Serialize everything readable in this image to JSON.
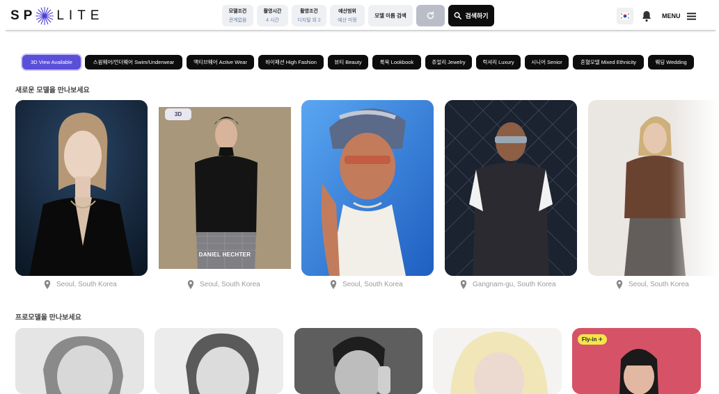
{
  "brand": {
    "left": "SP",
    "right": "LITE"
  },
  "filters": [
    {
      "title": "모델조건",
      "value": "관계없음"
    },
    {
      "title": "촬영시간",
      "value": "4 시간"
    },
    {
      "title": "촬영조건",
      "value": "디지털 외 2"
    },
    {
      "title": "예산범위",
      "value": "예산 미정"
    }
  ],
  "name_search_label": "모델 이름 검색",
  "search_button_label": "검색하기",
  "menu_label": "MENU",
  "categories": [
    "3D View Available",
    "스윔웨어/언더웨어 Swim/Underwear",
    "액티브웨어 Active Wear",
    "하이패션 High Fashion",
    "뷰티 Beauty",
    "룩북 Lookbook",
    "쥬얼리 Jewelry",
    "럭셔리 Luxury",
    "시니어 Senior",
    "혼혈모델 Mixed Ethnicity",
    "웨딩 Wedding"
  ],
  "section_new": {
    "title": "새로운 모델을 만나보세요",
    "models": [
      {
        "location": "Seoul, South Korea"
      },
      {
        "location": "Seoul, South Korea",
        "badge": "3D",
        "brand_text": "DANIEL HECHTER"
      },
      {
        "location": "Seoul, South Korea"
      },
      {
        "location": "Gangnam-gu, South Korea"
      },
      {
        "location": "Seoul, South Korea"
      }
    ]
  },
  "section_pro": {
    "title": "프로모델을 만나보세요",
    "models": [
      {},
      {},
      {},
      {},
      {
        "badge": "Fly-in ✈"
      }
    ]
  },
  "colors": {
    "accent": "#5a4fd8",
    "chip_bg": "#0d0d0d",
    "filter_bg": "#eef0f3",
    "filter_value": "#6c7fb0"
  }
}
